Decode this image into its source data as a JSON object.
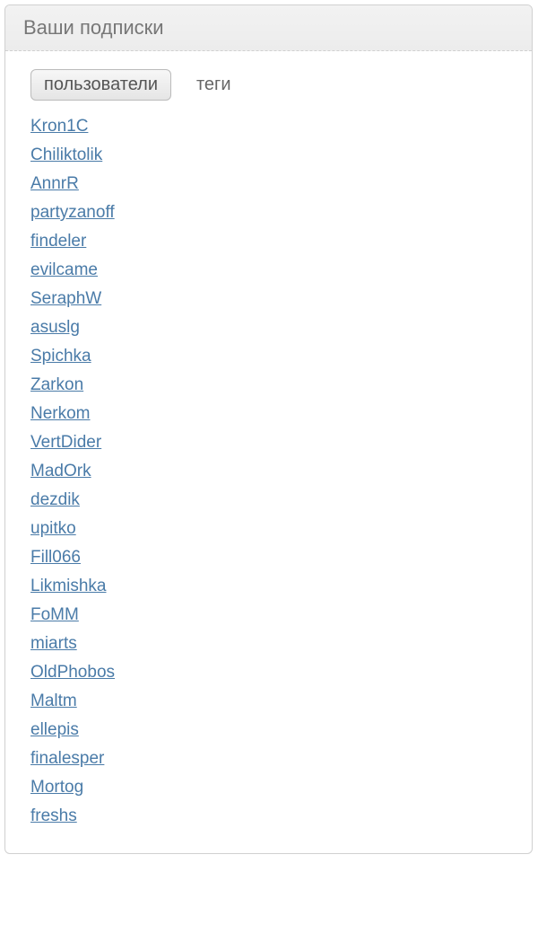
{
  "header": {
    "title": "Ваши подписки"
  },
  "tabs": {
    "active": "пользователи",
    "inactive": "теги"
  },
  "users": [
    "Kron1C",
    "Chiliktolik",
    "AnnrR",
    "partyzanoff",
    "findeler",
    "evilcame",
    "SeraphW",
    "asuslg",
    "Spichka",
    "Zarkon",
    "Nerkom",
    "VertDider",
    "MadOrk",
    "dezdik",
    "upitko",
    "Fill066",
    "Likmishka",
    "FoMM",
    "miarts",
    "OldPhobos",
    "Maltm",
    "ellepis",
    "finalesper",
    "Mortog",
    "freshs"
  ]
}
